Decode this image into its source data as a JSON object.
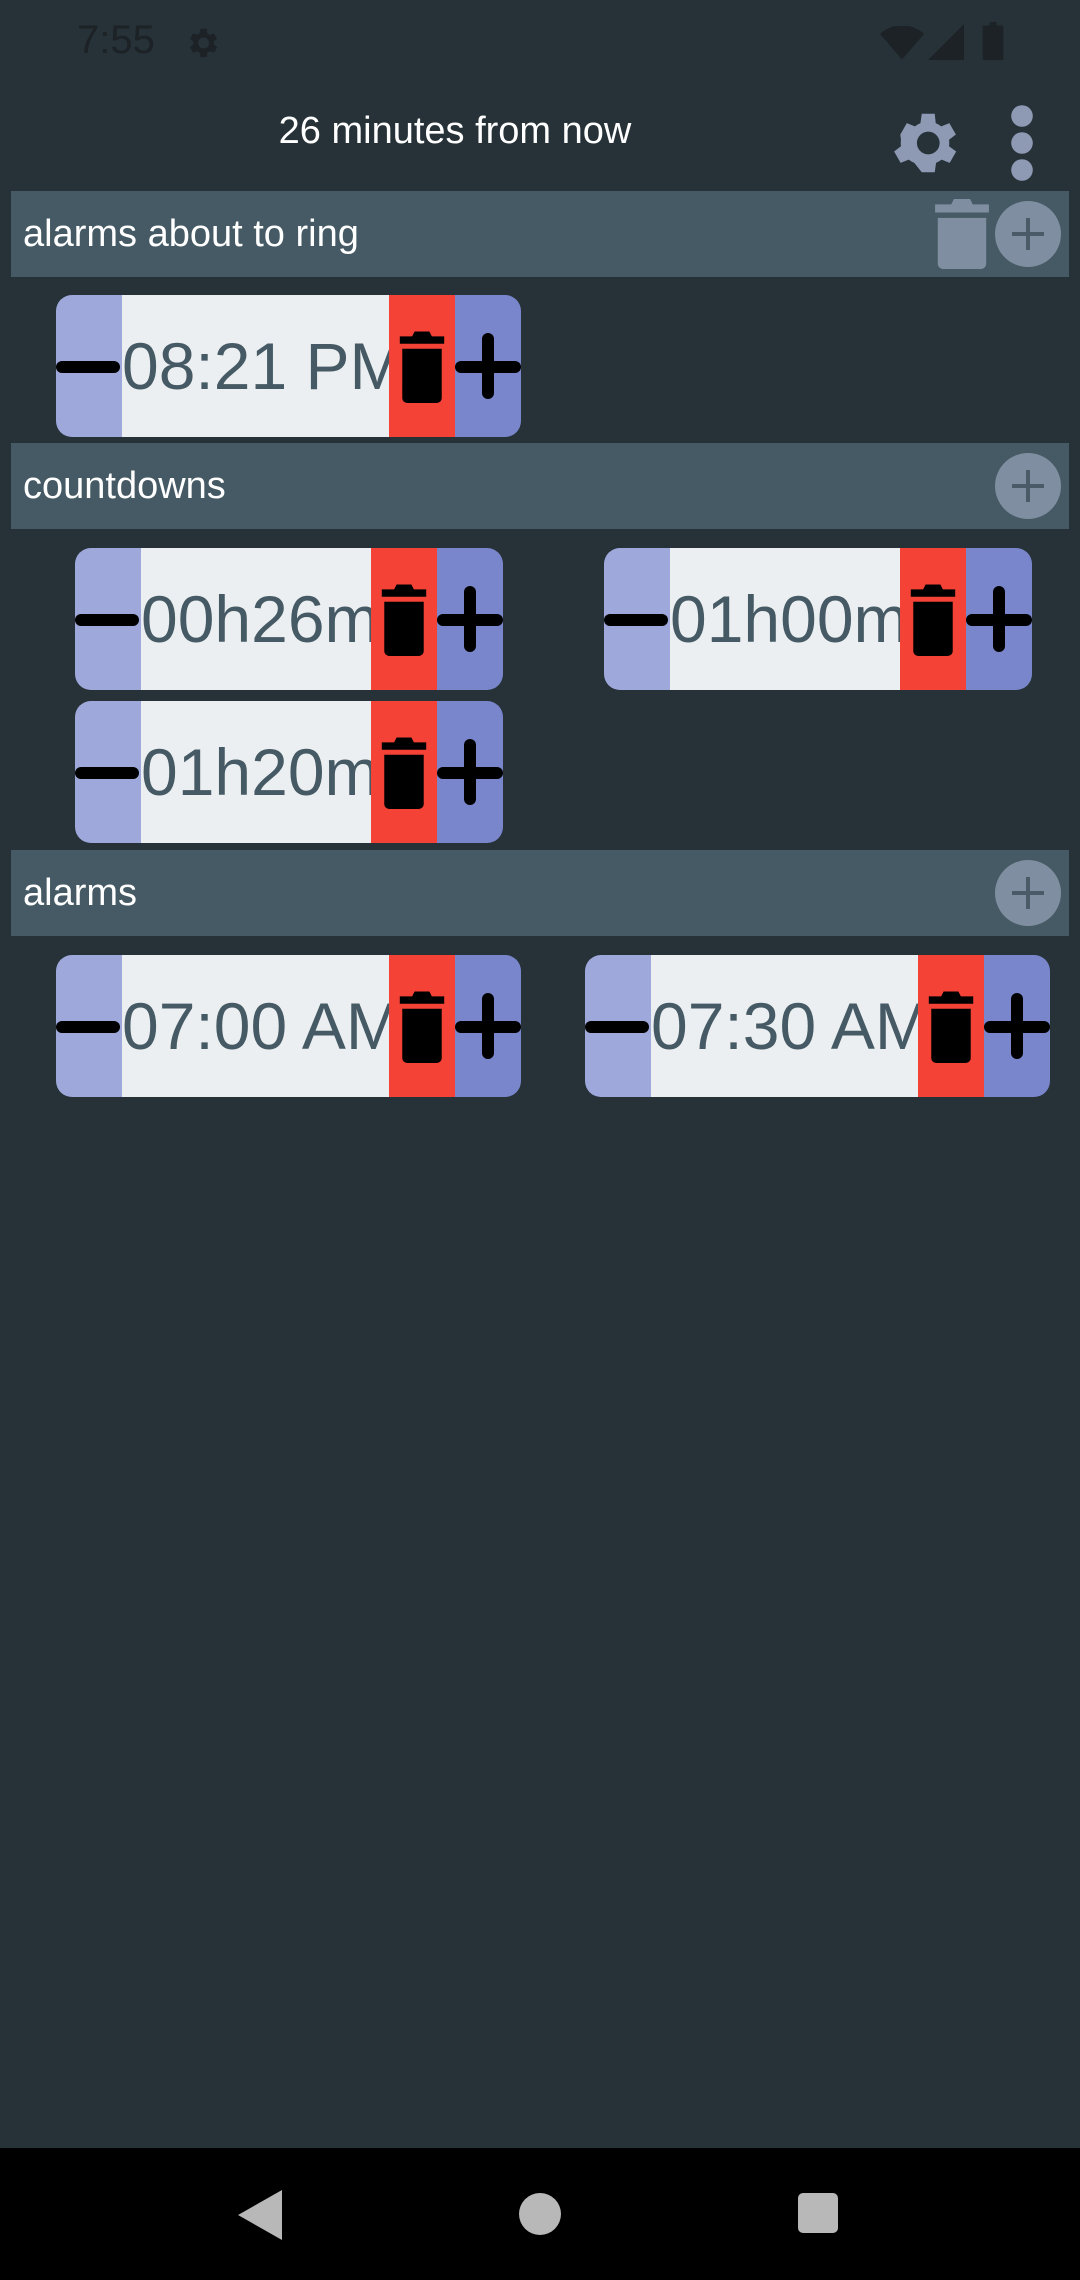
{
  "status_bar": {
    "time": "7:55"
  },
  "app_bar": {
    "title": "26 minutes from now"
  },
  "sections": {
    "ringing": {
      "title": "alarms about to ring",
      "items": [
        "08:21 PM"
      ]
    },
    "countdowns": {
      "title": "countdowns",
      "items": [
        "00h26m",
        "01h00m",
        "01h20m"
      ]
    },
    "alarms": {
      "title": "alarms",
      "items": [
        "07:00 AM",
        "07:30 AM"
      ]
    }
  },
  "colors": {
    "background": "#263238",
    "section_header": "#455a64",
    "minus_button": "#9fa8da",
    "plus_button": "#7986cb",
    "delete_button": "#f44336",
    "value_field": "#eceff1",
    "value_text": "#455a64"
  },
  "icons": {
    "status": [
      "gear-icon",
      "wifi-icon",
      "signal-icon",
      "battery-icon"
    ],
    "app_bar": [
      "settings-icon",
      "more-vert-icon"
    ],
    "widget": [
      "minus-icon",
      "trash-icon",
      "plus-icon"
    ],
    "nav": [
      "back-icon",
      "home-icon",
      "recents-icon"
    ]
  }
}
